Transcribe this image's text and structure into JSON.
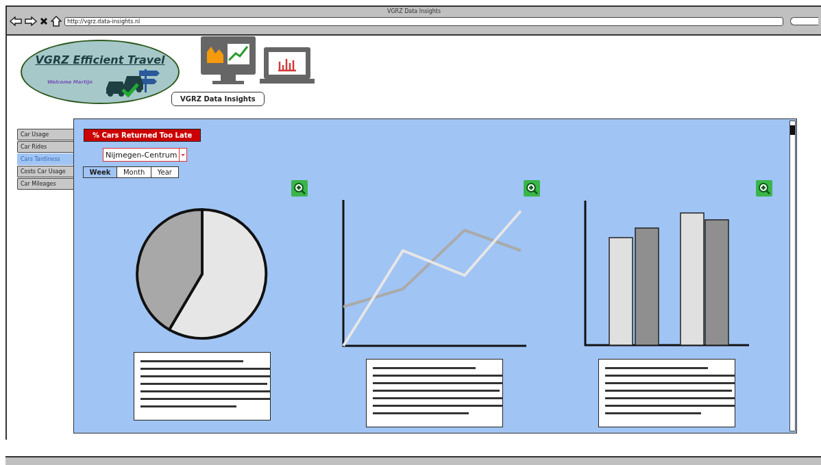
{
  "window": {
    "title": "VGRZ Data Insights",
    "url": "http://vgrz.data-insights.nl"
  },
  "logo": {
    "title": "VGRZ Efficient Travel",
    "welcome": "Welcome Martijn"
  },
  "callout": "VGRZ Data Insights",
  "sidebar": {
    "items": [
      {
        "label": "Car Usage",
        "selected": false
      },
      {
        "label": "Car Rides",
        "selected": false
      },
      {
        "label": "Cars Tardiness",
        "selected": true
      },
      {
        "label": "Costs Car Usage",
        "selected": false
      },
      {
        "label": "Car Mileages",
        "selected": false
      }
    ]
  },
  "report_title": "% Cars Returned Too Late",
  "location": {
    "value": "Nijmegen-Centrum"
  },
  "period": [
    {
      "label": "Week",
      "selected": true
    },
    {
      "label": "Month",
      "selected": false
    },
    {
      "label": "Year",
      "selected": false
    }
  ],
  "panels": [
    {
      "kind": "pie"
    },
    {
      "kind": "line"
    },
    {
      "kind": "bar"
    }
  ]
}
